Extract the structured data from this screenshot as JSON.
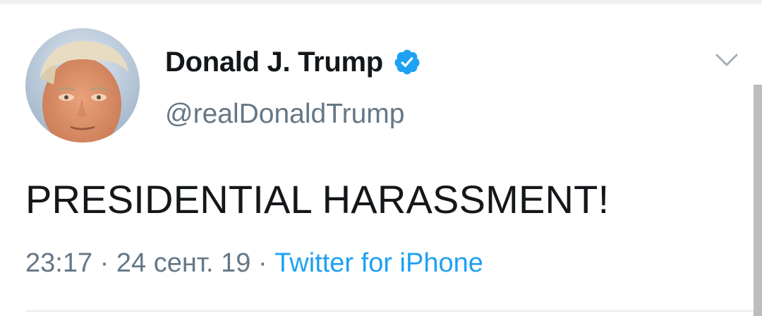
{
  "tweet": {
    "display_name": "Donald J. Trump",
    "handle": "@realDonaldTrump",
    "text": "PRESIDENTIAL HARASSMENT!",
    "time": "23:17",
    "separator": " · ",
    "date": "24 сент. 19",
    "source": "Twitter for iPhone",
    "verified": true
  },
  "icons": {
    "avatar": "profile-photo",
    "verified": "verified-badge-icon",
    "menu": "chevron-down-icon"
  },
  "colors": {
    "verified_blue": "#1da1f2",
    "source_link": "#1da1f2",
    "secondary_text": "#657786",
    "primary_text": "#14171a"
  }
}
